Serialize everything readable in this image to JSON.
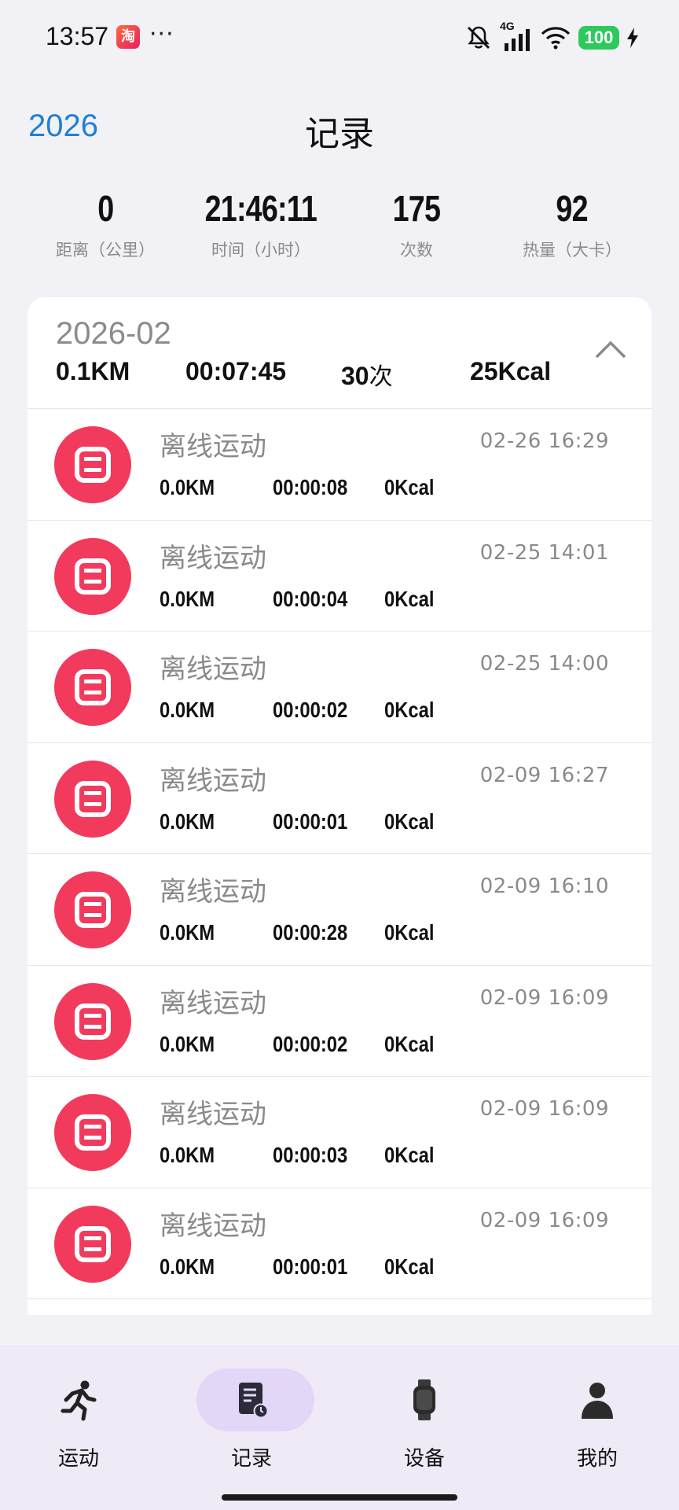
{
  "status_bar": {
    "time": "13:57",
    "app_icon_glyph": "淘",
    "more": "···",
    "network": "4G",
    "battery": "100"
  },
  "header": {
    "year": "2026",
    "title": "记录"
  },
  "summary": [
    {
      "value": "0",
      "label": "距离（公里）"
    },
    {
      "value": "21:46:11",
      "label": "时间（小时）"
    },
    {
      "value": "175",
      "label": "次数"
    },
    {
      "value": "92",
      "label": "热量（大卡）"
    }
  ],
  "month": {
    "title": "2026-02",
    "distance": "0.1KM",
    "duration": "00:07:45",
    "count_value": "30",
    "count_unit": "次",
    "calories": "25Kcal"
  },
  "records": [
    {
      "name": "离线运动",
      "date": "02-26 16:29",
      "distance": "0.0KM",
      "duration": "00:00:08",
      "calories": "0Kcal"
    },
    {
      "name": "离线运动",
      "date": "02-25 14:01",
      "distance": "0.0KM",
      "duration": "00:00:04",
      "calories": "0Kcal"
    },
    {
      "name": "离线运动",
      "date": "02-25 14:00",
      "distance": "0.0KM",
      "duration": "00:00:02",
      "calories": "0Kcal"
    },
    {
      "name": "离线运动",
      "date": "02-09 16:27",
      "distance": "0.0KM",
      "duration": "00:00:01",
      "calories": "0Kcal"
    },
    {
      "name": "离线运动",
      "date": "02-09 16:10",
      "distance": "0.0KM",
      "duration": "00:00:28",
      "calories": "0Kcal"
    },
    {
      "name": "离线运动",
      "date": "02-09 16:09",
      "distance": "0.0KM",
      "duration": "00:00:02",
      "calories": "0Kcal"
    },
    {
      "name": "离线运动",
      "date": "02-09 16:09",
      "distance": "0.0KM",
      "duration": "00:00:03",
      "calories": "0Kcal"
    },
    {
      "name": "离线运动",
      "date": "02-09 16:09",
      "distance": "0.0KM",
      "duration": "00:00:01",
      "calories": "0Kcal"
    }
  ],
  "nav": [
    {
      "label": "运动",
      "icon": "running-person-icon",
      "active": false
    },
    {
      "label": "记录",
      "icon": "record-document-icon",
      "active": true
    },
    {
      "label": "设备",
      "icon": "smartwatch-icon",
      "active": false
    },
    {
      "label": "我的",
      "icon": "user-profile-icon",
      "active": false
    }
  ],
  "colors": {
    "accent_blue": "#1e7fd8",
    "record_icon_red": "#f23a5c",
    "nav_active_pill": "#e2d7f6",
    "battery_green": "#2ec95c"
  }
}
